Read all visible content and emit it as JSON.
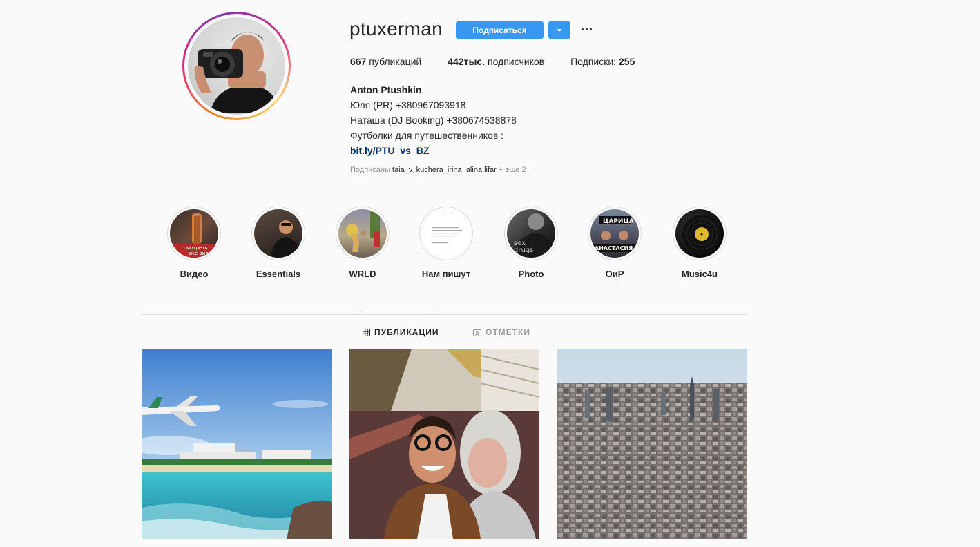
{
  "profile": {
    "username": "ptuxerman",
    "follow_label": "Подписаться",
    "stats": {
      "posts_count": "667",
      "posts_label": "публикаций",
      "followers_count": "442тыс.",
      "followers_label": "подписчиков",
      "following_label": "Подписки:",
      "following_count": "255"
    },
    "full_name": "Anton Ptushkin",
    "bio_lines": [
      "Юля (PR) +380967093918",
      "Наташа (DJ Booking) +380674538878",
      "Футболки для путешественников :"
    ],
    "link": "bit.ly/PTU_vs_BZ",
    "followed_by": {
      "prefix": "Подписаны",
      "users": [
        "taia_v",
        "kuchera_irina",
        "alina.lifar"
      ],
      "suffix": "+ еще 2"
    }
  },
  "highlights": [
    {
      "label": "Видео",
      "cover_text": [
        "смотреть",
        "все видео"
      ]
    },
    {
      "label": "Essentials"
    },
    {
      "label": "WRLD"
    },
    {
      "label": "Нам пишут"
    },
    {
      "label": "Photo",
      "cover_text": [
        "sex",
        "drugs"
      ]
    },
    {
      "label": "ОиР",
      "cover_text": [
        "ЦАРИЦА",
        "АНАСТАСИЯ"
      ]
    },
    {
      "label": "Music4u"
    }
  ],
  "tabs": {
    "posts": "ПУБЛИКАЦИИ",
    "tagged": "ОТМЕТКИ"
  },
  "colors": {
    "primary_button": "#3897f0",
    "link": "#003569",
    "muted": "#8e8e8e",
    "border": "#dbdbdb"
  },
  "icons": [
    "chevron-down-icon",
    "more-options-icon",
    "grid-icon",
    "tagged-icon"
  ]
}
